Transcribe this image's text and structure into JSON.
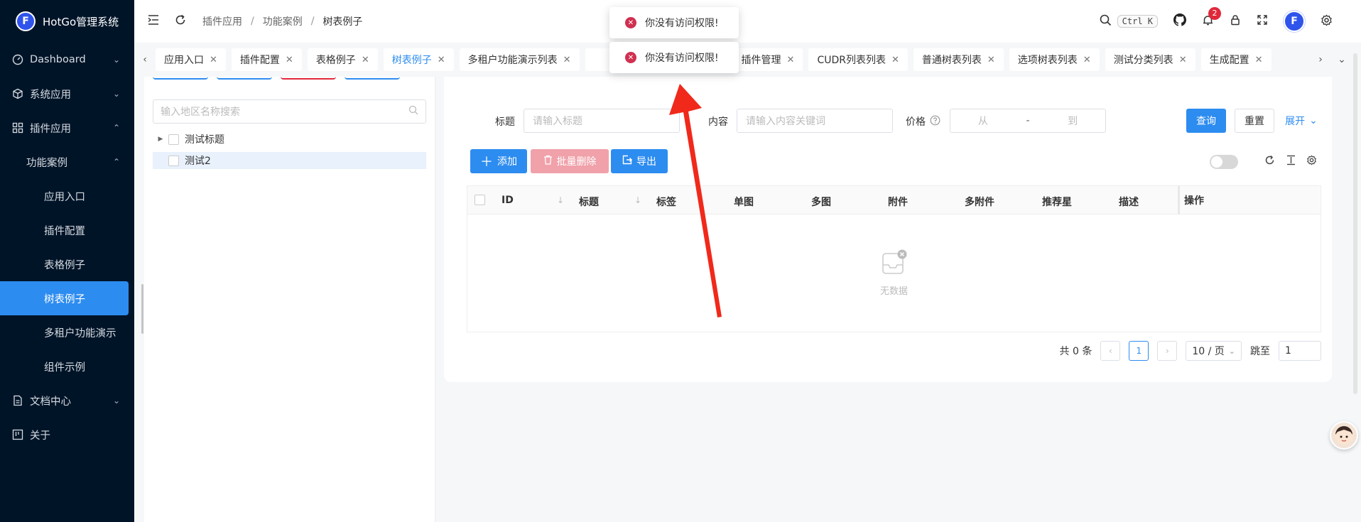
{
  "app": {
    "title": "HotGo管理系统",
    "logo_letter": "F"
  },
  "sidebar": {
    "items": [
      {
        "label": "Dashboard",
        "icon": "dashboard-icon",
        "chevron": "down"
      },
      {
        "label": "系统应用",
        "icon": "cube-icon",
        "chevron": "down"
      },
      {
        "label": "插件应用",
        "icon": "grid-icon",
        "chevron": "up"
      },
      {
        "label": "功能案例",
        "chevron": "up"
      },
      {
        "label": "应用入口"
      },
      {
        "label": "插件配置"
      },
      {
        "label": "表格例子"
      },
      {
        "label": "树表例子",
        "active": true
      },
      {
        "label": "多租户功能演示"
      },
      {
        "label": "组件示例"
      },
      {
        "label": "文档中心",
        "icon": "document-icon",
        "chevron": "down"
      },
      {
        "label": "关于",
        "icon": "board-icon"
      }
    ]
  },
  "header": {
    "breadcrumb": [
      "插件应用",
      "功能案例",
      "树表例子"
    ],
    "search_shortcut": "Ctrl K",
    "notification_count": "2",
    "avatar_letter": "F"
  },
  "tabs": [
    {
      "label": "应用入口"
    },
    {
      "label": "插件配置"
    },
    {
      "label": "表格例子"
    },
    {
      "label": "树表例子",
      "active": true
    },
    {
      "label": "多租户功能演示列表"
    },
    {
      "label": "插件管理"
    },
    {
      "label": "CUDR列表列表"
    },
    {
      "label": "普通树表列表"
    },
    {
      "label": "选项树表列表"
    },
    {
      "label": "测试分类列表"
    },
    {
      "label": "生成配置"
    }
  ],
  "tree": {
    "search_placeholder": "输入地区名称搜索",
    "nodes": [
      {
        "label": "测试标题",
        "expandable": true
      },
      {
        "label": "测试2",
        "selected": true
      }
    ]
  },
  "filters": {
    "title_label": "标题",
    "title_placeholder": "请输入标题",
    "content_label": "内容",
    "content_placeholder": "请输入内容关键词",
    "price_label": "价格",
    "price_from": "从",
    "price_sep": "-",
    "price_to": "到",
    "query_button": "查询",
    "reset_button": "重置",
    "expand_button": "展开"
  },
  "toolbar": {
    "add_button": "添加",
    "batch_delete_button": "批量删除",
    "export_button": "导出"
  },
  "table": {
    "columns": [
      "ID",
      "标题",
      "标签",
      "单图",
      "多图",
      "附件",
      "多附件",
      "推荐星",
      "描述",
      "操作"
    ],
    "empty_text": "无数据"
  },
  "pagination": {
    "total_text": "共 0 条",
    "current_page": "1",
    "page_size": "10 / 页",
    "jump_label": "跳至",
    "jump_value": "1"
  },
  "toasts": [
    {
      "text": "你没有访问权限!"
    },
    {
      "text": "你没有访问权限!"
    }
  ],
  "colors": {
    "primary": "#2d8cf0",
    "sidebar_bg": "#001428",
    "error": "#d03050",
    "annotation_arrow": "#f0291b"
  }
}
